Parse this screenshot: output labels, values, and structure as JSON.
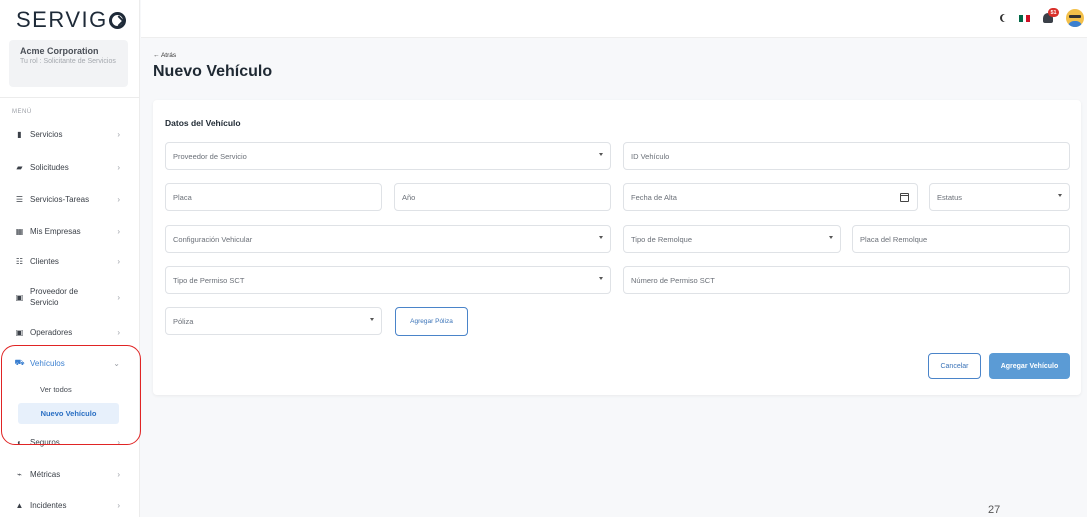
{
  "brand": {
    "logo_text": "SERVIG",
    "logo_tail": ""
  },
  "company": {
    "name": "Acme Corporation",
    "role": "Tu rol : Solicitante de Servicios"
  },
  "menu_label": "MENÚ",
  "sidebar": {
    "items": [
      {
        "label": "Servicios",
        "icon": "suitcase-icon"
      },
      {
        "label": "Solicitudes",
        "icon": "truck-hand-icon"
      },
      {
        "label": "Servicios-Tareas",
        "icon": "list-icon"
      },
      {
        "label": "Mis Empresas",
        "icon": "building-icon"
      },
      {
        "label": "Clientes",
        "icon": "users-icon"
      },
      {
        "label": "Proveedor de Servicio",
        "icon": "id-card-icon"
      },
      {
        "label": "Operadores",
        "icon": "id-badge-icon"
      },
      {
        "label": "Vehículos",
        "icon": "truck-icon"
      },
      {
        "label": "Seguros",
        "icon": "shield-icon"
      },
      {
        "label": "Métricas",
        "icon": "chart-line-icon"
      },
      {
        "label": "Incidentes",
        "icon": "warning-icon"
      }
    ],
    "vehiculos_sub": {
      "ver_todos": "Ver todos",
      "nuevo": "Nuevo Vehículo"
    }
  },
  "topbar": {
    "notification_count": "51",
    "flag_colors": [
      "#006847",
      "#ffffff",
      "#ce1126"
    ]
  },
  "header": {
    "back_label": "← Atrás",
    "title": "Nuevo Vehículo"
  },
  "form": {
    "section_title": "Datos del Vehículo",
    "proveedor": "Proveedor de Servicio",
    "id_vehiculo": "ID Vehículo",
    "placa": "Placa",
    "anio": "Año",
    "fecha_alta": "Fecha de Alta",
    "estatus": "Estatus",
    "configuracion": "Configuración Vehicular",
    "tipo_remolque": "Tipo de Remolque",
    "placa_remolque": "Placa del Remolque",
    "tipo_permiso": "Tipo de Permiso SCT",
    "numero_permiso": "Número de Permiso SCT",
    "poliza": "Póliza",
    "agregar_poliza": "Agregar Póliza",
    "cancelar": "Cancelar",
    "agregar_vehiculo": "Agregar Vehículo"
  },
  "page_number": "27",
  "colors": {
    "accent": "#3a7fd0",
    "highlight": "#e02424",
    "primary_button": "#5b9bd5"
  }
}
